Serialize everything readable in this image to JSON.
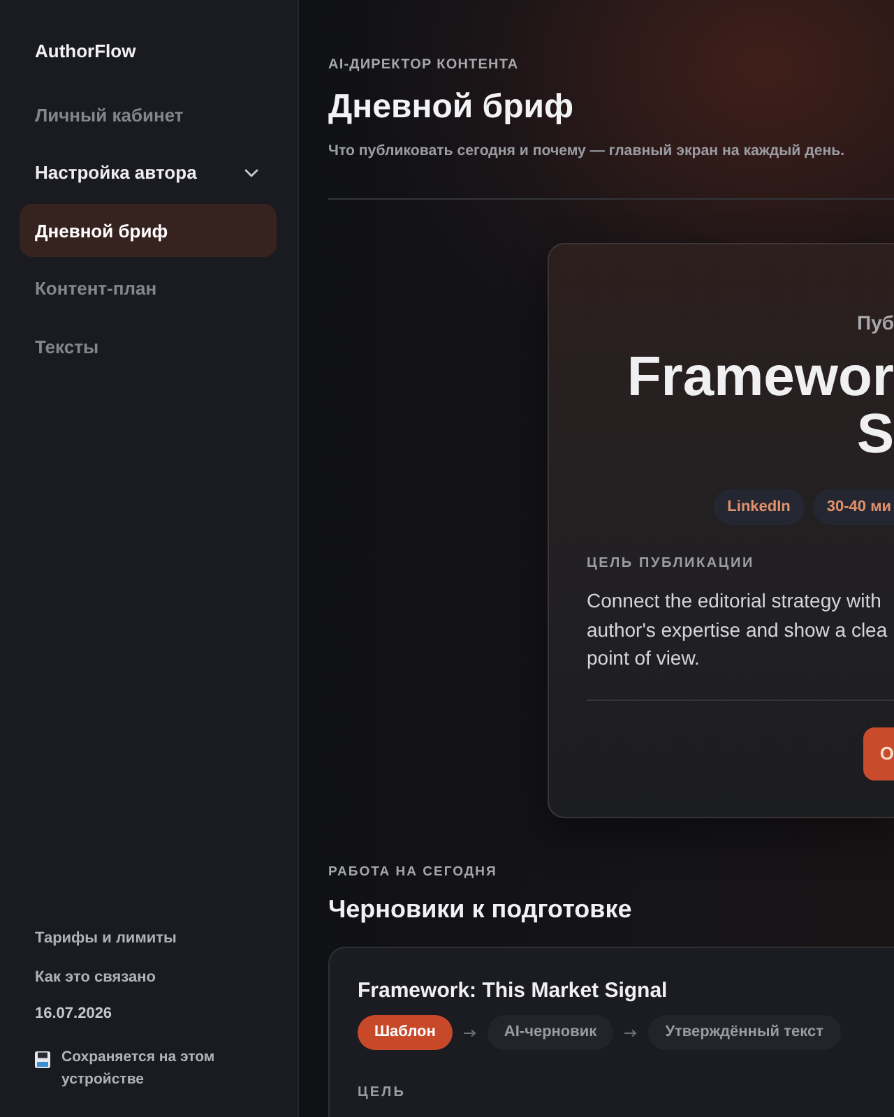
{
  "sidebar": {
    "brand": "AuthorFlow",
    "nav": [
      {
        "label": "Личный кабинет",
        "kind": "link",
        "selected": false
      },
      {
        "label": "Настройка автора",
        "kind": "group",
        "expanded": false,
        "selected": false
      },
      {
        "label": "Дневной бриф",
        "kind": "link",
        "selected": true
      },
      {
        "label": "Контент-план",
        "kind": "link",
        "selected": false
      },
      {
        "label": "Тексты",
        "kind": "link",
        "selected": false
      }
    ],
    "footer_links": [
      "Тарифы и лимиты",
      "Как это связано"
    ],
    "date": "16.07.2026",
    "save_note": "Сохраняется на этом устройстве"
  },
  "header": {
    "eyebrow": "AI-ДИРЕКТОР КОНТЕНТА",
    "title": "Дневной бриф",
    "subtitle": "Что публиковать сегодня и почему — главный экран на каждый день."
  },
  "brief_card": {
    "eyebrow": "Пуб",
    "title_lines": [
      "Framewor",
      "S"
    ],
    "tags": [
      "LinkedIn",
      "30-40 ми"
    ],
    "goal_label": "ЦЕЛЬ ПУБЛИКАЦИИ",
    "goal_lines": [
      "Connect the editorial strategy with",
      "author's expertise and show a clea",
      "point of view."
    ],
    "button": "О"
  },
  "drafts": {
    "eyebrow": "РАБОТА НА СЕГОДНЯ",
    "title": "Черновики к подготовке",
    "items": [
      {
        "title": "Framework: This Market Signal",
        "stages": [
          {
            "label": "Шаблон",
            "current": true
          },
          {
            "label": "AI-черновик",
            "current": false
          },
          {
            "label": "Утверждённый текст",
            "current": false
          }
        ],
        "goal_label": "ЦЕЛЬ"
      }
    ]
  }
}
